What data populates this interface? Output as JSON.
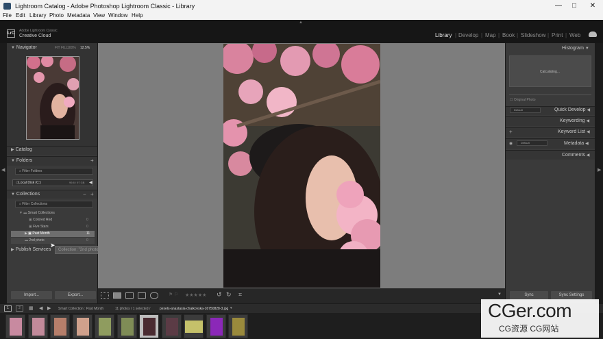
{
  "window": {
    "title": "Lightroom Catalog - Adobe Photoshop Lightroom Classic - Library",
    "minimize_glyph": "—",
    "maximize_glyph": "□",
    "close_glyph": "✕"
  },
  "menu": [
    "File",
    "Edit",
    "Library",
    "Photo",
    "Metadata",
    "View",
    "Window",
    "Help"
  ],
  "identity": {
    "logo_text": "LrC",
    "brand_line1": "Adobe Lightroom Classic",
    "brand_line2": "Creative Cloud"
  },
  "modules": [
    "Library",
    "Develop",
    "Map",
    "Book",
    "Slideshow",
    "Print",
    "Web"
  ],
  "active_module": "Library",
  "left_panel": {
    "navigator": {
      "title": "Navigator",
      "zoom_options": [
        "FIT",
        "FILL",
        "100%"
      ],
      "zoom_current": "12.5%"
    },
    "catalog": {
      "title": "Catalog"
    },
    "folders": {
      "title": "Folders",
      "filter_placeholder": "Filter Folders",
      "disk_label": "Local Disk (C:)",
      "disk_size": "99.8 / 97 GB"
    },
    "collections": {
      "title": "Collections",
      "filter_placeholder": "Filter Collections",
      "items": [
        {
          "label": "Smart Collections",
          "count": ""
        },
        {
          "label": "Colored Red",
          "count": "0"
        },
        {
          "label": "Five Stars",
          "count": "0"
        },
        {
          "label": "Past Month",
          "count": "11"
        },
        {
          "label": "2nd photo",
          "count": "0"
        }
      ],
      "tooltip": "Collection: \"2nd photo\""
    },
    "publish": {
      "title": "Publish Services"
    },
    "import_label": "Import...",
    "export_label": "Export..."
  },
  "right_panel": {
    "histogram": {
      "title": "Histogram",
      "status": "Calculating...",
      "original_photo_label": "Original Photo"
    },
    "quick_develop": {
      "title": "Quick Develop",
      "preset": "Default"
    },
    "keywording": {
      "title": "Keywording"
    },
    "keyword_list": {
      "title": "Keyword List"
    },
    "metadata": {
      "title": "Metadata",
      "preset": "Default"
    },
    "comments": {
      "title": "Comments"
    },
    "sync_label": "Sync",
    "sync_settings_label": "Sync Settings"
  },
  "filmstrip_bar": {
    "page_1": "1",
    "page_2": "2",
    "source": "Smart Collection : Past Month",
    "count": "11 photos / 1 selected /",
    "filename": "pexels-anastasia-chaikovska-16750828-3.jpg"
  },
  "watermark": {
    "line1": "CGer.com",
    "line2": "CG资源 CG网站"
  },
  "colors": {
    "accent": "#e6e6e6",
    "panel": "#3a3a3a",
    "center": "#7d7d7d"
  },
  "filmstrip_thumbs": [
    {
      "name": "thumb-1",
      "color": "#c88aa0"
    },
    {
      "name": "thumb-2",
      "color": "#c28a9a"
    },
    {
      "name": "thumb-3",
      "color": "#b67e6a"
    },
    {
      "name": "thumb-4",
      "color": "#d0a18c"
    },
    {
      "name": "thumb-5",
      "color": "#8f9c5f"
    },
    {
      "name": "thumb-6",
      "color": "#7f8c56"
    },
    {
      "name": "thumb-7",
      "color": "#4a2b31"
    },
    {
      "name": "thumb-8",
      "color": "#5b3b45"
    },
    {
      "name": "thumb-9",
      "color": "#c5c16a"
    },
    {
      "name": "thumb-10",
      "color": "#8b28b8"
    },
    {
      "name": "thumb-11",
      "color": "#9a8a3c"
    }
  ]
}
